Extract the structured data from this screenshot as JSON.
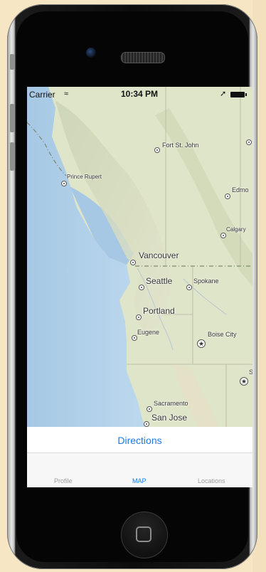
{
  "status_bar": {
    "carrier": "Carrier",
    "time": "10:34 PM",
    "wifi_icon": "wifi-icon",
    "location_icon": "location-arrow-icon",
    "battery_icon": "battery-icon"
  },
  "map": {
    "cities": {
      "fort_st_john": "Fort St. John",
      "prince_rupert": "Prince Rupert",
      "edmonton": "Edmo",
      "calgary": "Calgary",
      "vancouver": "Vancouver",
      "seattle": "Seattle",
      "spokane": "Spokane",
      "portland": "Portland",
      "eugene": "Eugene",
      "boise_city": "Boise City",
      "sacramento": "Sacramento",
      "san_jose": "San Jose",
      "cut_s": "S"
    }
  },
  "directions_button": {
    "label": "Directions"
  },
  "tab_bar": {
    "tabs": [
      {
        "label": "Profile"
      },
      {
        "label": "MAP"
      },
      {
        "label": "Locations"
      }
    ]
  },
  "colors": {
    "accent": "#1a7ae8",
    "tab_inactive": "#9e9e9e",
    "ocean": "#aecde6",
    "land": "#dde3c6"
  }
}
